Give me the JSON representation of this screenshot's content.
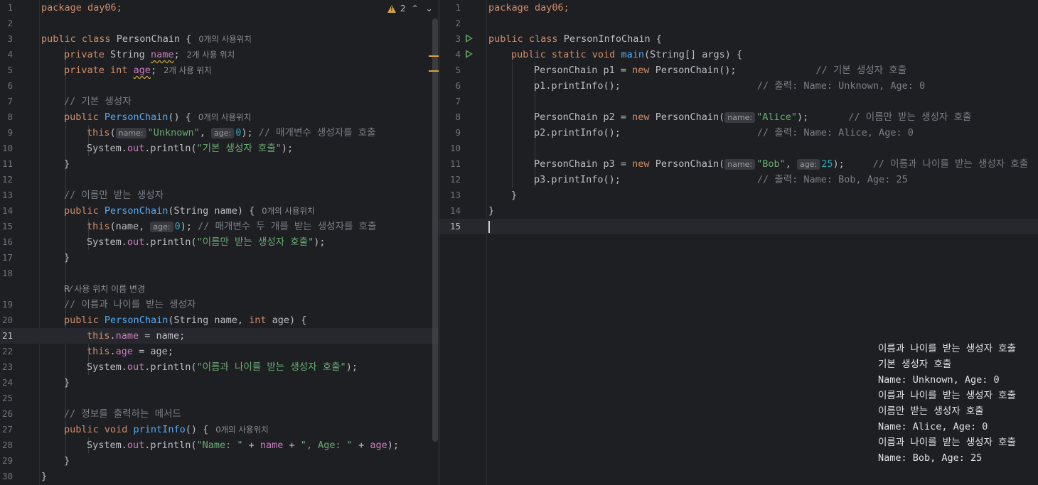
{
  "editor_left": {
    "file_class": "PersonChain",
    "warning_count": "2",
    "lines": {
      "l1": [
        "package day06;"
      ],
      "l3": [
        "public class",
        "PersonChain {",
        "0개의 사용위치"
      ],
      "l4": [
        "private",
        "String",
        "name",
        ";",
        "2개 사용 위치"
      ],
      "l5": [
        "private int",
        "age",
        ";",
        "2개 사용 위치"
      ],
      "l7": [
        "// 기본 생성자"
      ],
      "l8": [
        "public",
        "PersonChain",
        "() {",
        "0개의 사용위치"
      ],
      "l9": [
        "this",
        "(",
        "name:",
        "\"Unknown\"",
        ", ",
        "age:",
        "0",
        "); ",
        "// 매개변수 생성자를 호출"
      ],
      "l10": [
        "System.",
        "out",
        ".println(",
        "\"기본 생성자 호출\"",
        ");"
      ],
      "l11": [
        "}"
      ],
      "l13": [
        "// 이름만 받는 생성자"
      ],
      "l14": [
        "public",
        "PersonChain",
        "(String name) {",
        "0개의 사용위치"
      ],
      "l15": [
        "this",
        "(name, ",
        "age:",
        "0",
        "); ",
        "// 매개변수 두 개를 받는 생성자를 호출"
      ],
      "l16": [
        "System.",
        "out",
        ".println(",
        "\"이름만 받는 생성자 호출\"",
        ");"
      ],
      "l17": [
        "}"
      ],
      "rename": "사용 위치 이름 변경",
      "l19": [
        "// 이름과 나이를 받는 생성자"
      ],
      "l20": [
        "public",
        "PersonChain",
        "(String name, ",
        "int",
        " age) {"
      ],
      "l21": [
        "this",
        ".",
        "name",
        " = name;"
      ],
      "l22": [
        "this",
        ".",
        "age",
        " = age;"
      ],
      "l23": [
        "System.",
        "out",
        ".println(",
        "\"이름과 나이를 받는 생성자 호출\"",
        ");"
      ],
      "l24": [
        "}"
      ],
      "l26": [
        "// 정보를 출력하는 메서드"
      ],
      "l27": [
        "public void",
        "printInfo",
        "() {",
        "0개의 사용위치"
      ],
      "l28": [
        "System.",
        "out",
        ".println(",
        "\"Name: \"",
        " + ",
        "name",
        " + ",
        "\", Age: \"",
        " + ",
        "age",
        ");"
      ],
      "l29": [
        "}"
      ],
      "l30": [
        "}"
      ]
    }
  },
  "editor_right": {
    "file_class": "PersonInfoChain",
    "lines": {
      "l1": [
        "package day06;"
      ],
      "l3": [
        "public class",
        "PersonInfoChain {"
      ],
      "l4": [
        "public static void",
        "main",
        "(String[] args) {"
      ],
      "l5": [
        "PersonChain p1 = ",
        "new",
        " PersonChain();",
        "// 기본 생성자 호출"
      ],
      "l6": [
        "p1.printInfo();",
        "// 출력: Name: Unknown, Age: 0"
      ],
      "l8": [
        "PersonChain p2 = ",
        "new",
        " PersonChain(",
        "name:",
        "\"Alice\"",
        ");",
        "// 이름만 받는 생성자 호출"
      ],
      "l9": [
        "p2.printInfo();",
        "// 출력: Name: Alice, Age: 0"
      ],
      "l11": [
        "PersonChain p3 = ",
        "new",
        " PersonChain(",
        "name:",
        "\"Bob\"",
        ", ",
        "age:",
        "25",
        ");",
        "// 이름과 나이를 받는 생성자 호출"
      ],
      "l12": [
        "p3.printInfo();",
        "// 출력: Name: Bob, Age: 25"
      ],
      "l13": [
        "}"
      ],
      "l14": [
        "}"
      ]
    }
  },
  "console_output": [
    "이름과 나이를 받는 생성자 호출",
    "기본 생성자 호출",
    "Name: Unknown, Age: 0",
    "이름과 나이를 받는 생성자 호출",
    "이름만 받는 생성자 호출",
    "Name: Alice, Age: 0",
    "이름과 나이를 받는 생성자 호출",
    "Name: Bob, Age: 25"
  ],
  "icons": {
    "warning": "warning-triangle-icon",
    "nav_up": "chevron-up-icon",
    "nav_down": "chevron-down-icon",
    "run": "run-gutter-icon",
    "rename": "rename-icon"
  },
  "colors": {
    "background": "#1e1f22",
    "keyword": "#cf8e6d",
    "string": "#6aab73",
    "method": "#56a8f5",
    "field": "#c77dbb",
    "number": "#2aacb8",
    "comment": "#7a7e85",
    "warning": "#d9a343",
    "run": "#57965c"
  }
}
